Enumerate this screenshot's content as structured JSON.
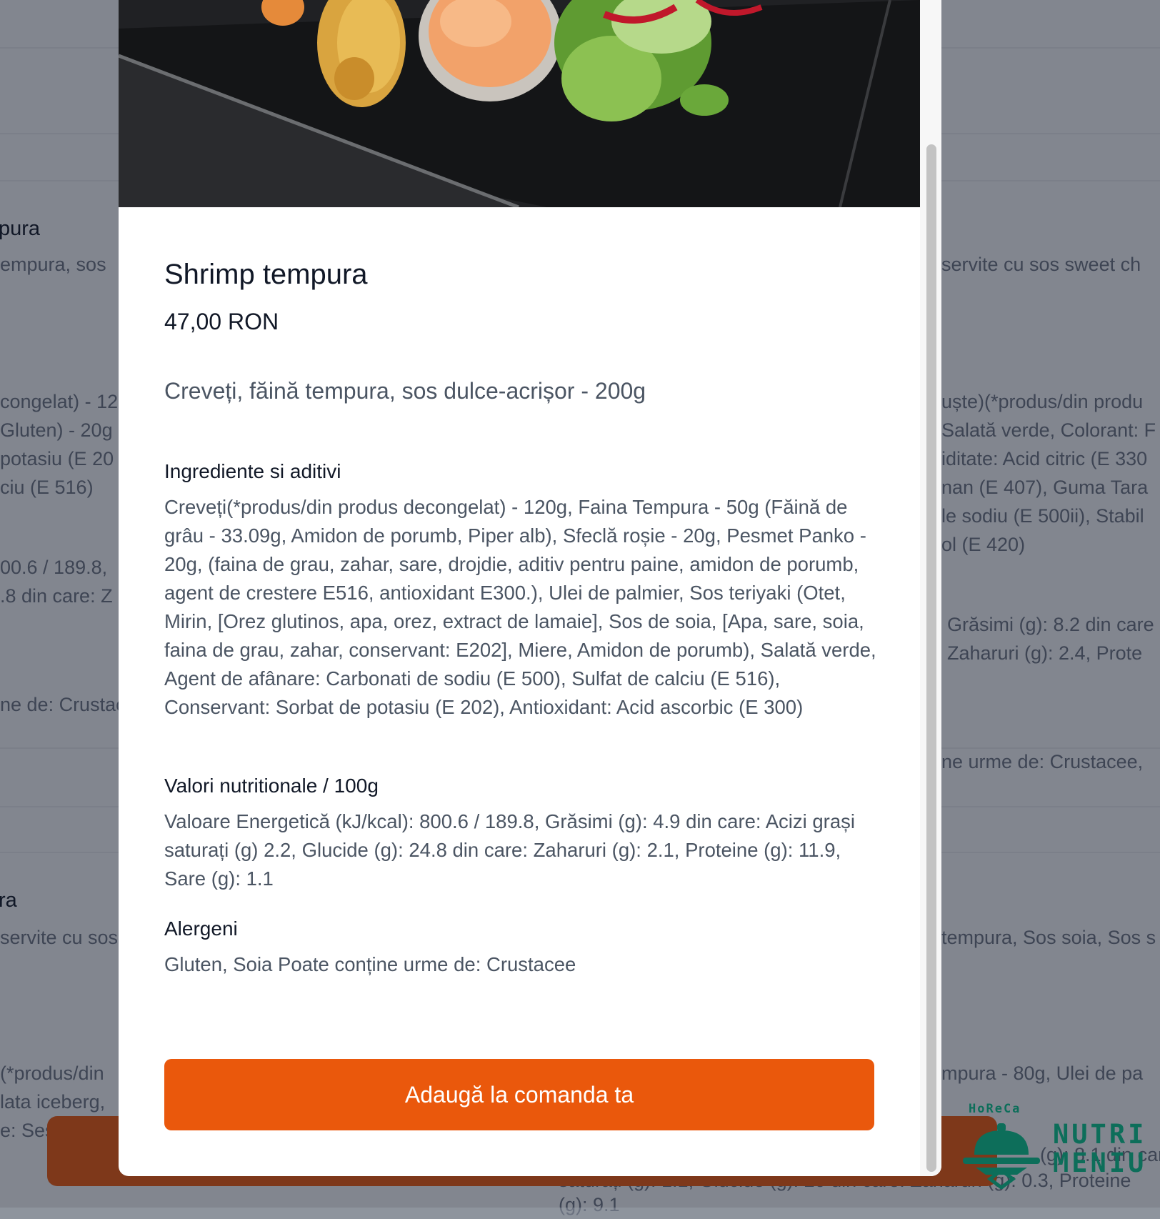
{
  "modal": {
    "title": "Shrimp tempura",
    "price": "47,00 RON",
    "description": "Creveți, făină tempura, sos dulce-acrișor - 200g",
    "sections": [
      {
        "heading": "Ingrediente si aditivi",
        "body": "Creveți(*produs/din produs decongelat) - 120g, Faina Tempura - 50g (Făină de grâu - 33.09g, Amidon de porumb, Piper alb), Sfeclă roșie - 20g, Pesmet Panko - 20g, (faina de grau, zahar, sare, drojdie, aditiv pentru paine, amidon de porumb, agent de crestere E516, antioxidant E300.), Ulei de palmier, Sos teriyaki (Otet, Mirin, [Orez glutinos, apa, orez, extract de lamaie], Sos de soia, [Apa, sare, soia, faina de grau, zahar, conservant: E202], Miere, Amidon de porumb), Salată verde, Agent de afânare: Carbonati de sodiu (E 500), Sulfat de calciu (E 516), Conservant: Sorbat de potasiu (E 202), Antioxidant: Acid ascorbic (E 300)"
      },
      {
        "heading": "Valori nutritionale / 100g",
        "body": "Valoare Energetică (kJ/kcal): 800.6 / 189.8, Grăsimi (g): 4.9 din care: Acizi grași saturați (g) 2.2, Glucide (g): 24.8 din care: Zaharuri (g): 2.1, Proteine (g): 11.9, Sare (g): 1.1"
      },
      {
        "heading": "Alergeni",
        "body": "Gluten, Soia Poate conține urme de: Crustacee"
      }
    ],
    "add_button": "Adaugă la comanda ta"
  },
  "background": {
    "left_title_1": "pura",
    "left_title_2": "ra",
    "left_lines_a": [
      "empura, sos"
    ],
    "left_lines_b": [
      "congelat) - 12",
      "Gluten) - 20g",
      "potasiu (E 20",
      "ciu (E 516)"
    ],
    "left_lines_c": [
      "00.6 / 189.8,",
      ".8 din care: Z"
    ],
    "left_lines_d": [
      "ne de: Crustac"
    ],
    "left_lines_e": [
      "servite cu sos"
    ],
    "left_lines_f": [
      "(*produs/din",
      "lata iceberg,",
      "e: Ses"
    ],
    "right_lines_a": [
      "servite cu sos sweet ch"
    ],
    "right_lines_b": [
      "uște)(*produs/din produ",
      "Salată verde, Colorant: F",
      "iditate: Acid citric (E 330",
      "nan (E 407), Guma Tara",
      "le sodiu (E 500ii), Stabil",
      "ol (E 420)"
    ],
    "right_lines_c": [
      "Grăsimi (g): 8.2 din care",
      "Zaharuri (g): 2.4, Prote"
    ],
    "right_lines_d": [
      "ne urme de: Crustacee,"
    ],
    "right_lines_e": [
      "tempura, Sos soia, Sos s"
    ],
    "right_lines_f": [
      "mpura - 80g, Ulei de pa",
      "(g): 8.1 din car",
      "saturați (g): 1.1, Glucide (g): 20 din care: Zaharuri (g): 0.3, Proteine",
      "(g): 9.1"
    ]
  },
  "logo": {
    "top": "HoReCa",
    "word1": "NUTRI",
    "word2": "MENIU"
  },
  "colors": {
    "accent": "#ea580c",
    "title_text": "#111827",
    "body_text": "#4b5563",
    "logo_green": "#0d6e5a"
  }
}
